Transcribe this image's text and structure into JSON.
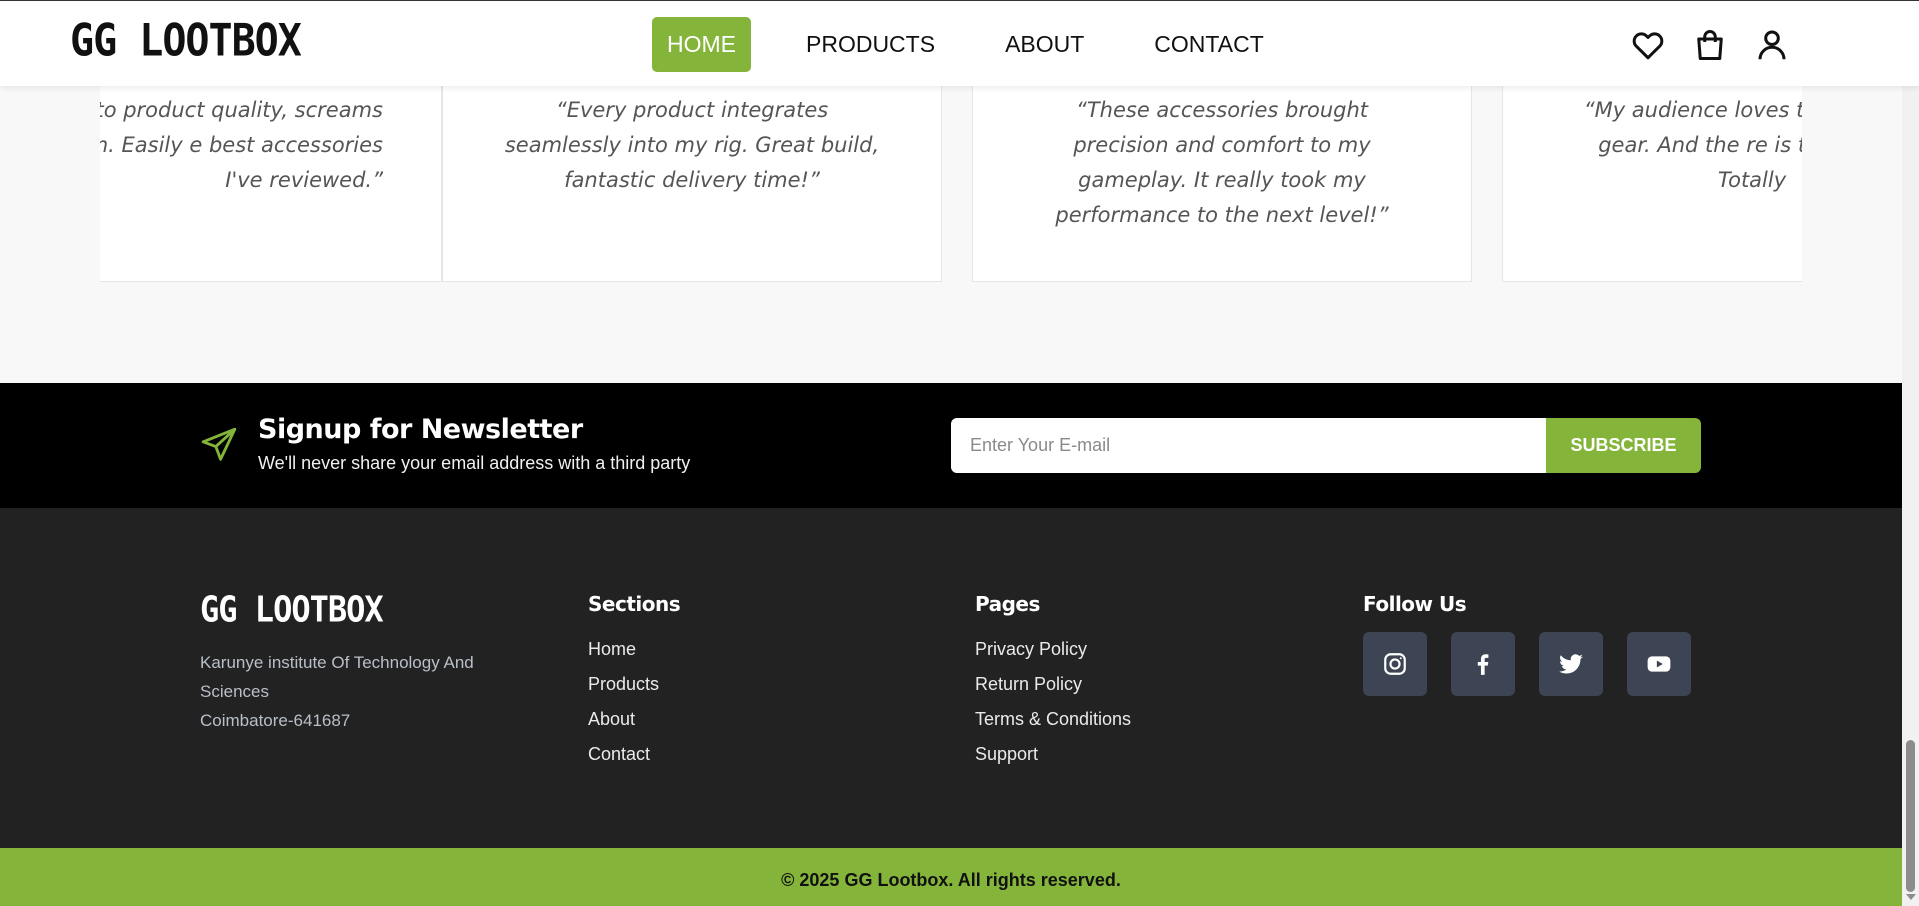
{
  "header": {
    "logo": "GG LOOTBOX",
    "nav": [
      {
        "label": "HOME",
        "active": true
      },
      {
        "label": "PRODUCTS",
        "active": false
      },
      {
        "label": "ABOUT",
        "active": false
      },
      {
        "label": "CONTACT",
        "active": false
      }
    ],
    "icons": [
      "heart-icon",
      "shopping-bag-icon",
      "user-icon"
    ]
  },
  "testimonials": [
    {
      "quote": "aging to product quality, screams premium. Easily e best accessories I've reviewed.”"
    },
    {
      "quote": "“Every product integrates seamlessly into my rig. Great build, fantastic delivery time!”"
    },
    {
      "quote": "“These accessories brought precision and comfort to my gameplay. It really took my performance to the next level!”"
    },
    {
      "quote": "“My audience loves the my new gear. And the re is top-notch. Totally"
    }
  ],
  "newsletter": {
    "icon": "paper-plane-icon",
    "title": "Signup for Newsletter",
    "subtitle": "We'll never share your email address with a third party",
    "placeholder": "Enter Your E-mail",
    "button": "SUBSCRIBE"
  },
  "footer": {
    "logo": "GG LOOTBOX",
    "address_line1": "Karunye institute Of Technology And Sciences",
    "address_line2": "Coimbatore-641687",
    "sections": {
      "title": "Sections",
      "links": [
        "Home",
        "Products",
        "About",
        "Contact"
      ]
    },
    "pages": {
      "title": "Pages",
      "links": [
        "Privacy Policy",
        "Return Policy",
        "Terms & Conditions",
        "Support"
      ]
    },
    "follow": {
      "title": "Follow Us",
      "icons": [
        "instagram-icon",
        "facebook-icon",
        "twitter-icon",
        "youtube-icon"
      ]
    }
  },
  "copyright": "© 2025 GG Lootbox. All rights reserved.",
  "colors": {
    "accent": "#84b53a",
    "newsletter_bg": "#000000",
    "footer_bg": "#222222",
    "social_bg": "#3d4554"
  }
}
